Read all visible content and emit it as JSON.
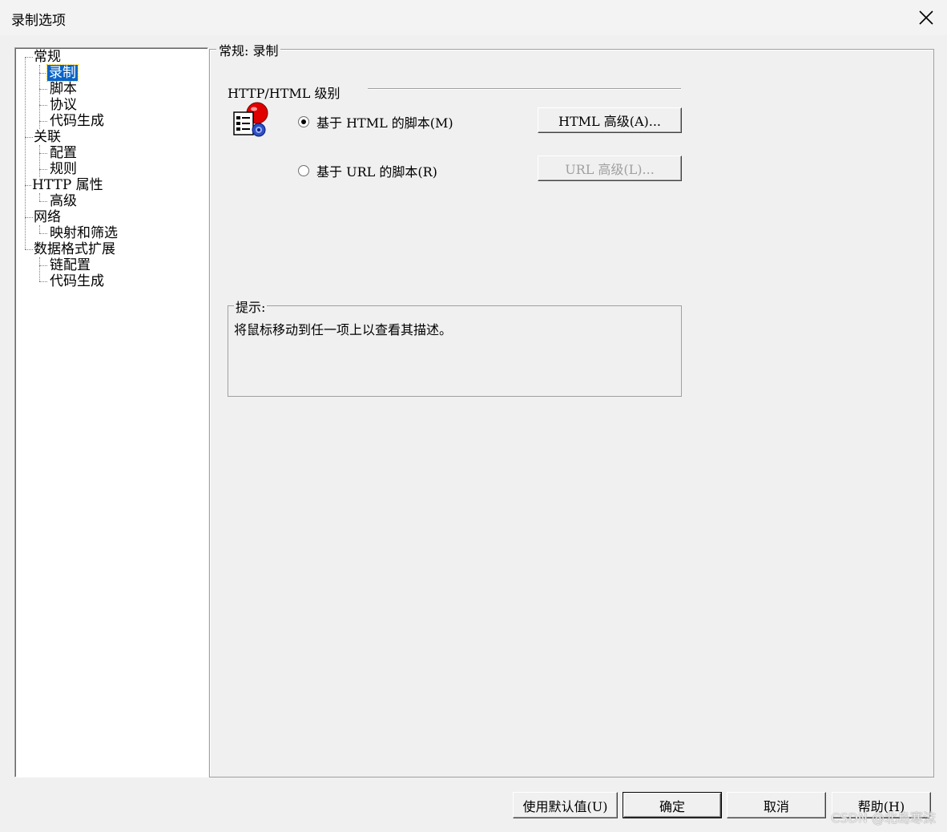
{
  "window": {
    "title": "录制选项"
  },
  "tree": {
    "items": [
      {
        "label": "常规"
      },
      {
        "label": "录制"
      },
      {
        "label": "脚本"
      },
      {
        "label": "协议"
      },
      {
        "label": "代码生成"
      },
      {
        "label": "关联"
      },
      {
        "label": "配置"
      },
      {
        "label": "规则"
      },
      {
        "label": "HTTP 属性"
      },
      {
        "label": "高级"
      },
      {
        "label": "网络"
      },
      {
        "label": "映射和筛选"
      },
      {
        "label": "数据格式扩展"
      },
      {
        "label": "链配置"
      },
      {
        "label": "代码生成"
      }
    ],
    "selected": "录制"
  },
  "panel": {
    "group_title": "常规: 录制",
    "section_title": "HTTP/HTML 级别",
    "radio_html": {
      "label": "基于 HTML 的脚本(M)",
      "checked": true
    },
    "radio_url": {
      "label": "基于 URL 的脚本(R)",
      "checked": false
    },
    "html_advanced_button": "HTML 高级(A)...",
    "url_advanced_button": "URL 高级(L)...",
    "hint_title": "提示:",
    "hint_text": "将鼠标移动到任一项上以查看其描述。"
  },
  "footer": {
    "defaults_button": "使用默认值(U)",
    "ok_button": "确定",
    "cancel_button": "取消",
    "help_button": "帮助(H)"
  },
  "watermark": "CSDN @北岛寒沫"
}
